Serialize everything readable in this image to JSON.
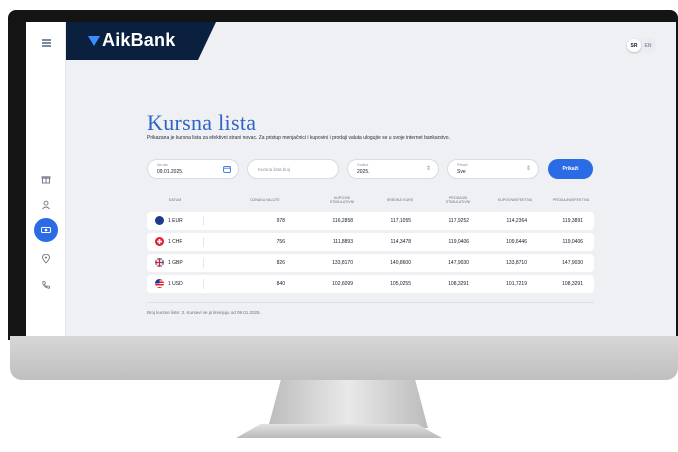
{
  "bank_name": "AikBank",
  "language": {
    "options": [
      "SR",
      "EN"
    ],
    "selected": "SR"
  },
  "sidebar": {
    "icons": [
      "menu-icon",
      "gift-icon",
      "user-icon",
      "currency-icon",
      "location-icon",
      "phone-icon"
    ],
    "active": "currency-icon"
  },
  "page": {
    "title": "Kursna lista",
    "subtitle": "Prikazana je kursna lista za efektivni strani novac. Za pristup menjačnici i kupovini i prodaji valuta ulogujte se u svoje internet bankarstvo."
  },
  "filters": {
    "date": {
      "label": "Na dan",
      "value": "09.01.2025."
    },
    "list_number": {
      "placeholder": "Kursna lista broj"
    },
    "year": {
      "label": "Godina",
      "value": "2025."
    },
    "show": {
      "label": "Prikaži",
      "value": "Sve"
    },
    "submit_label": "Prikaži"
  },
  "table": {
    "headers": [
      "DATUM",
      "OZNAKA VALUTE",
      "KUPOVNI\nSTIMULATIVNI",
      "SREDNJI KURS",
      "PRODAJNI\nSTIMULATIVNI",
      "KUPOVNI/EFEKTIVA",
      "PRODAJNI/EFEKTIVA"
    ],
    "rows": [
      {
        "currency": "1 EUR",
        "code": "978",
        "buy_stim": "116,2858",
        "middle": "117,1055",
        "sell_stim": "117,9252",
        "buy_eff": "114,2364",
        "sell_eff": "119,3891"
      },
      {
        "currency": "1 CHF",
        "code": "756",
        "buy_stim": "111,8893",
        "middle": "114,3478",
        "sell_stim": "119,0406",
        "buy_eff": "109,6446",
        "sell_eff": "119,0406"
      },
      {
        "currency": "1 GBP",
        "code": "826",
        "buy_stim": "133,8170",
        "middle": "140,8600",
        "sell_stim": "147,9030",
        "buy_eff": "133,8710",
        "sell_eff": "147,9030"
      },
      {
        "currency": "1 USD",
        "code": "840",
        "buy_stim": "102,6099",
        "middle": "105,0255",
        "sell_stim": "108,3291",
        "buy_eff": "101,7219",
        "sell_eff": "108,3291"
      }
    ]
  },
  "footnote": "Broj kursne liste: 3. Kursevi se primenjuju od 09.01.2025.",
  "colors": {
    "brand_navy": "#0b1f3f",
    "accent_blue": "#2b6be6",
    "title_blue": "#2f63c9"
  }
}
